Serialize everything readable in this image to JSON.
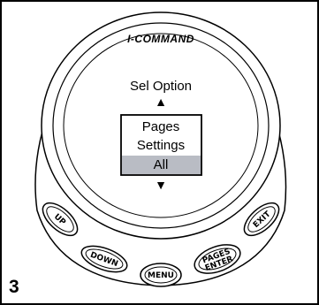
{
  "device": {
    "brand": "I-COMMAND"
  },
  "screen": {
    "title": "Sel Option",
    "up_arrow": "▲",
    "down_arrow": "▼",
    "options": [
      "Pages",
      "Settings",
      "All"
    ],
    "selected_option": "All"
  },
  "buttons": {
    "up": "UP",
    "down": "DOWN",
    "menu": "MENU",
    "pages_enter_line1": "PAGES",
    "pages_enter_line2": "ENTER",
    "exit": "EXIT"
  },
  "figure_number": "3",
  "colors": {
    "selected_bg": "#b9bcc4",
    "outline": "#000000"
  }
}
